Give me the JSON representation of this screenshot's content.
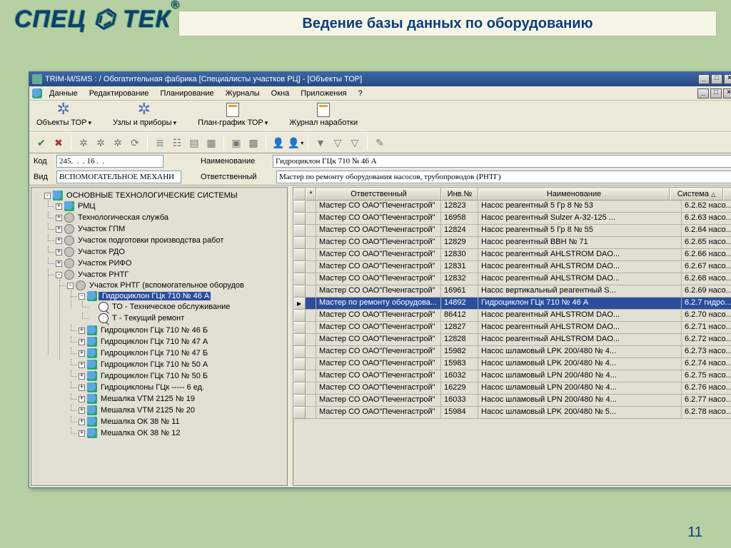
{
  "brand": "СПЕЦ ⌬ ТЕК",
  "brand_r": "®",
  "banner_title": "Ведение базы данных по оборудованию",
  "page_number": "11",
  "window": {
    "title": "TRIM-M/SMS :                                                             / Обогатительная фабрика  [Специалисты участков РЦ] - [Объекты ТОР]",
    "min": "_",
    "max": "□",
    "close": "×"
  },
  "menu": {
    "items": [
      "Данные",
      "Редактирование",
      "Планирование",
      "Журналы",
      "Окна",
      "Приложения",
      "?"
    ]
  },
  "bigtoolbar": {
    "items": [
      {
        "label": "Объекты ТОР",
        "type": "gear",
        "dd": true
      },
      {
        "label": "Узлы и приборы",
        "type": "gear",
        "dd": true
      },
      {
        "label": "План-график ТОР",
        "type": "doc",
        "dd": true
      },
      {
        "label": "Журнал наработки",
        "type": "doc",
        "dd": false
      }
    ]
  },
  "smalltoolbar_icons": [
    "check",
    "xmark",
    "|",
    "gear",
    "gear",
    "gear",
    "refresh",
    "|",
    "stack",
    "tree",
    "sheet",
    "card",
    "|",
    "boxE",
    "boxG",
    "|",
    "user",
    "userdd",
    "|",
    "funnel1",
    "funnel2",
    "funnel3",
    "|",
    "wizard"
  ],
  "form": {
    "kod_label": "Код",
    "kod_value": "245.  .  . 16 .  .",
    "name_label": "Наименование",
    "name_value": "Гидроциклон ГЦк 710 № 46 А",
    "vid_label": "Вид",
    "vid_value": "ВСПОМОГАТЕЛЬНОЕ МЕХАНИ",
    "otv_label": "Ответственный",
    "otv_value": "Мастер по ремонту оборудования насосов, трубопроводов (РНТГ)"
  },
  "tree": {
    "root": "ОСНОВНЫЕ ТЕХНОЛОГИЧЕСКИЕ СИСТЕМЫ",
    "children": [
      {
        "label": "РМЦ",
        "exp": "+",
        "icon": "main"
      },
      {
        "label": "Технологическая служба",
        "exp": "+",
        "icon": "sub"
      },
      {
        "label": "Участок ГПМ",
        "exp": "+",
        "icon": "sub"
      },
      {
        "label": "Участок подготовки производства работ",
        "exp": "+",
        "icon": "sub"
      },
      {
        "label": "Участок РДО",
        "exp": "+",
        "icon": "sub"
      },
      {
        "label": "Участок РИФО",
        "exp": "+",
        "icon": "sub"
      },
      {
        "label": "Участок РНТГ",
        "exp": "-",
        "icon": "sub",
        "children": [
          {
            "label": "Участок РНТГ (вспомогательное оборудов",
            "exp": "-",
            "icon": "sub",
            "children": [
              {
                "label": "Гидроциклон ГЦк 710 № 46 А",
                "exp": "-",
                "icon": "main",
                "selected": true,
                "children": [
                  {
                    "label": "ТО - Техническое обслуживание",
                    "icon": "search"
                  },
                  {
                    "label": "Т - Тeкущий ремонт",
                    "icon": "search"
                  }
                ]
              },
              {
                "label": "Гидроциклон ГЦк 710 № 46 Б",
                "exp": "+",
                "icon": "main"
              },
              {
                "label": "Гидроциклон ГЦк 710 № 47 А",
                "exp": "+",
                "icon": "main"
              },
              {
                "label": "Гидроциклон ГЦк 710 № 47 Б",
                "exp": "+",
                "icon": "main"
              },
              {
                "label": "Гидроциклон ГЦк 710 № 50 А",
                "exp": "+",
                "icon": "main"
              },
              {
                "label": "Гидроциклон ГЦк 710 № 50 Б",
                "exp": "+",
                "icon": "main"
              },
              {
                "label": "Гидроциклоны ГЦк ----- 6 ед.",
                "exp": "+",
                "icon": "main"
              },
              {
                "label": "Мешалка VTM 2125 № 19",
                "exp": "+",
                "icon": "main"
              },
              {
                "label": "Мешалка VTM 2125 № 20",
                "exp": "+",
                "icon": "main"
              },
              {
                "label": "Мешалка ОК 38 № 11",
                "exp": "+",
                "icon": "main"
              },
              {
                "label": "Мешалка ОК 38 № 12",
                "exp": "+",
                "icon": "main"
              }
            ]
          }
        ]
      }
    ]
  },
  "grid": {
    "headers": {
      "star": "*",
      "resp": "Ответственный",
      "inv": "Инв.№",
      "name": "Наименование",
      "sys": "Система"
    },
    "rows": [
      {
        "resp": "Мастер СО ОАО\"Печенгастрой\"",
        "inv": "12823",
        "name": "Насос реагентный 5 Гр 8 № 53",
        "sys": "6.2.62 насо..."
      },
      {
        "resp": "Мастер СО ОАО\"Печенгастрой\"",
        "inv": "16958",
        "name": "Насос реагентный Sulzer A-32-125 ...",
        "sys": "6.2.63 насо..."
      },
      {
        "resp": "Мастер СО ОАО\"Печенгастрой\"",
        "inv": "12824",
        "name": "Насос реагентный 5 Гр 8 № 55",
        "sys": "6.2.64 насо..."
      },
      {
        "resp": "Мастер СО ОАО\"Печенгастрой\"",
        "inv": "12829",
        "name": "Насос реагентный ВВН № 71",
        "sys": "6.2.65 насо..."
      },
      {
        "resp": "Мастер СО ОАО\"Печенгастрой\"",
        "inv": "12830",
        "name": "Насос реагентный AHLSTROM DAO...",
        "sys": "6.2.66 насо..."
      },
      {
        "resp": "Мастер СО ОАО\"Печенгастрой\"",
        "inv": "12831",
        "name": "Насос реагентный AHLSTROM DAO...",
        "sys": "6.2.67 насо..."
      },
      {
        "resp": "Мастер СО ОАО\"Печенгастрой\"",
        "inv": "12832",
        "name": "Насос реагентный AHLSTROM DAO...",
        "sys": "6.2.68 насо..."
      },
      {
        "resp": "Мастер СО ОАО\"Печенгастрой\"",
        "inv": "16961",
        "name": "Насос вертикальный реагентный S...",
        "sys": "6.2.69 насо..."
      },
      {
        "resp": "Мастер по ремонту оборудова...",
        "inv": "14892",
        "name": "Гидроциклон ГЦк 710 № 46 А",
        "sys": "6.2.7 гидро...",
        "selected": true
      },
      {
        "resp": "Мастер СО ОАО\"Печенгастрой\"",
        "inv": "86412",
        "name": "Насос реагентный AHLSTROM DAO...",
        "sys": "6.2.70 насо..."
      },
      {
        "resp": "Мастер СО ОАО\"Печенгастрой\"",
        "inv": "12827",
        "name": "Насос реагентный AHLSTROM DAO...",
        "sys": "6.2.71 насо..."
      },
      {
        "resp": "Мастер СО ОАО\"Печенгастрой\"",
        "inv": "12828",
        "name": "Насос реагентный AHLSTROM DAO...",
        "sys": "6.2.72 насо..."
      },
      {
        "resp": "Мастер СО ОАО\"Печенгастрой\"",
        "inv": "15982",
        "name": "Насос шламовый LPK 200/480 № 4...",
        "sys": "6.2.73 насо..."
      },
      {
        "resp": "Мастер СО ОАО\"Печенгастрой\"",
        "inv": "15983",
        "name": "Насос шламовый LPK 200/480 № 4...",
        "sys": "6.2.74 насо..."
      },
      {
        "resp": "Мастер СО ОАО\"Печенгастрой\"",
        "inv": "16032",
        "name": "Насос шламовый LPN 200/480 № 4...",
        "sys": "6.2.75 насо..."
      },
      {
        "resp": "Мастер СО ОАО\"Печенгастрой\"",
        "inv": "16229",
        "name": "Насос шламовый LPN 200/480 № 4...",
        "sys": "6.2.76 насо..."
      },
      {
        "resp": "Мастер СО ОАО\"Печенгастрой\"",
        "inv": "16033",
        "name": "Насос шламовый LPN 200/480 № 4...",
        "sys": "6.2.77 насо..."
      },
      {
        "resp": "Мастер СО ОАО\"Печенгастрой\"",
        "inv": "15984",
        "name": "Насос шламовый LPK 200/480 № 5...",
        "sys": "6.2.78 насо..."
      }
    ]
  }
}
